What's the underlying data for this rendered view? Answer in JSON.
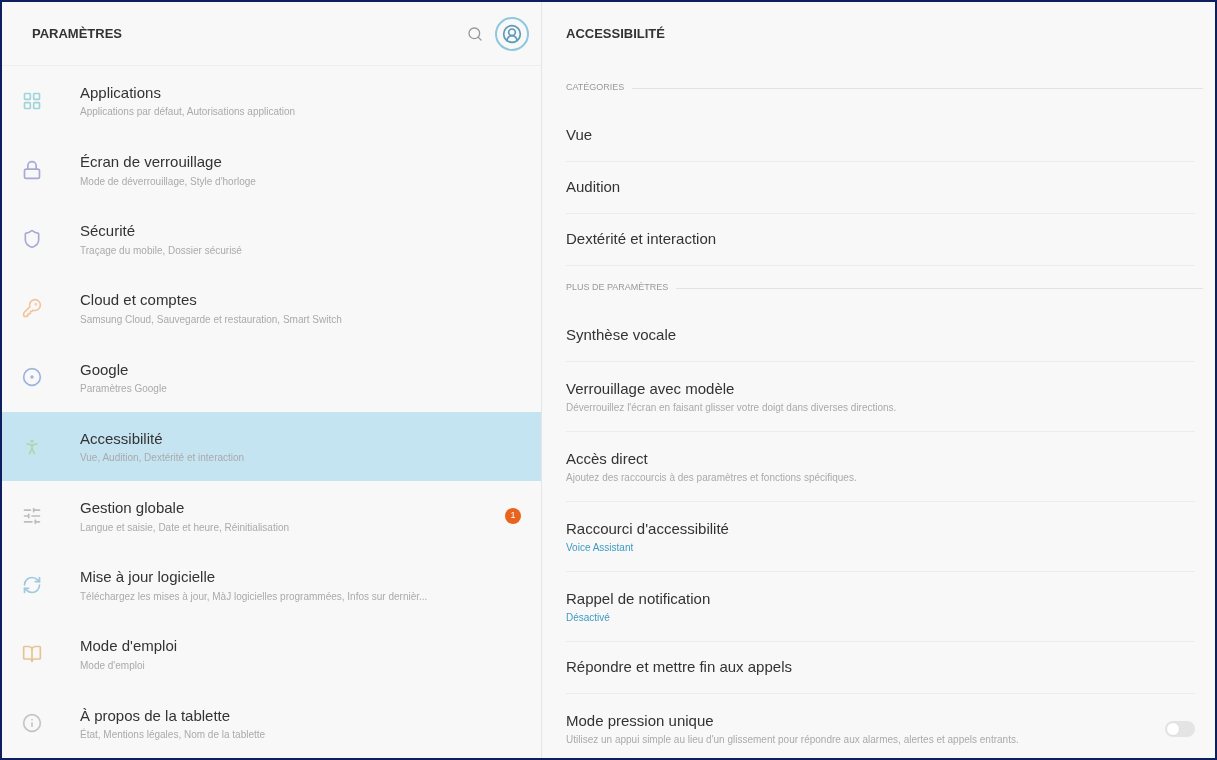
{
  "left_panel": {
    "title": "PARAMÈTRES",
    "items": [
      {
        "title": "Applications",
        "subtitle": "Applications par défaut, Autorisations application",
        "selected": false
      },
      {
        "title": "Écran de verrouillage",
        "subtitle": "Mode de déverrouillage, Style d'horloge",
        "selected": false
      },
      {
        "title": "Sécurité",
        "subtitle": "Traçage du mobile, Dossier sécurisé",
        "selected": false
      },
      {
        "title": "Cloud et comptes",
        "subtitle": "Samsung Cloud, Sauvegarde et restauration, Smart Switch",
        "selected": false
      },
      {
        "title": "Google",
        "subtitle": "Paramètres Google",
        "selected": false
      },
      {
        "title": "Accessibilité",
        "subtitle": "Vue, Audition, Dextérité et interaction",
        "selected": true
      },
      {
        "title": "Gestion globale",
        "subtitle": "Langue et saisie, Date et heure, Réinitialisation",
        "badge": "1",
        "selected": false
      },
      {
        "title": "Mise à jour logicielle",
        "subtitle": "Téléchargez les mises à jour, MàJ logicielles programmées, Infos sur dernièr...",
        "selected": false
      },
      {
        "title": "Mode d'emploi",
        "subtitle": "Mode d'emploi",
        "selected": false
      },
      {
        "title": "À propos de la tablette",
        "subtitle": "État, Mentions légales, Nom de la tablette",
        "selected": false
      }
    ]
  },
  "right_panel": {
    "title": "ACCESSIBILITÉ",
    "sections": [
      {
        "label": "CATÉGORIES",
        "items": [
          {
            "kind": "link",
            "title": "Vue"
          },
          {
            "kind": "link",
            "title": "Audition"
          },
          {
            "kind": "link",
            "title": "Dextérité et interaction"
          }
        ]
      },
      {
        "label": "PLUS DE PARAMÈTRES",
        "items": [
          {
            "kind": "link",
            "title": "Synthèse vocale"
          },
          {
            "kind": "link",
            "title": "Verrouillage avec modèle",
            "subtitle": "Déverrouillez l'écran en faisant glisser votre doigt dans diverses directions."
          },
          {
            "kind": "link",
            "title": "Accès direct",
            "subtitle": "Ajoutez des raccourcis à des paramètres et fonctions spécifiques."
          },
          {
            "kind": "link",
            "title": "Raccourci d'accessibilité",
            "value": "Voice Assistant"
          },
          {
            "kind": "link",
            "title": "Rappel de notification",
            "value": "Désactivé"
          },
          {
            "kind": "link",
            "title": "Répondre et mettre fin aux appels"
          },
          {
            "kind": "toggle",
            "title": "Mode pression unique",
            "subtitle": "Utilisez un appui simple au lieu d'un glissement pour répondre aux alarmes, alertes et appels entrants.",
            "on": false
          }
        ]
      }
    ]
  }
}
